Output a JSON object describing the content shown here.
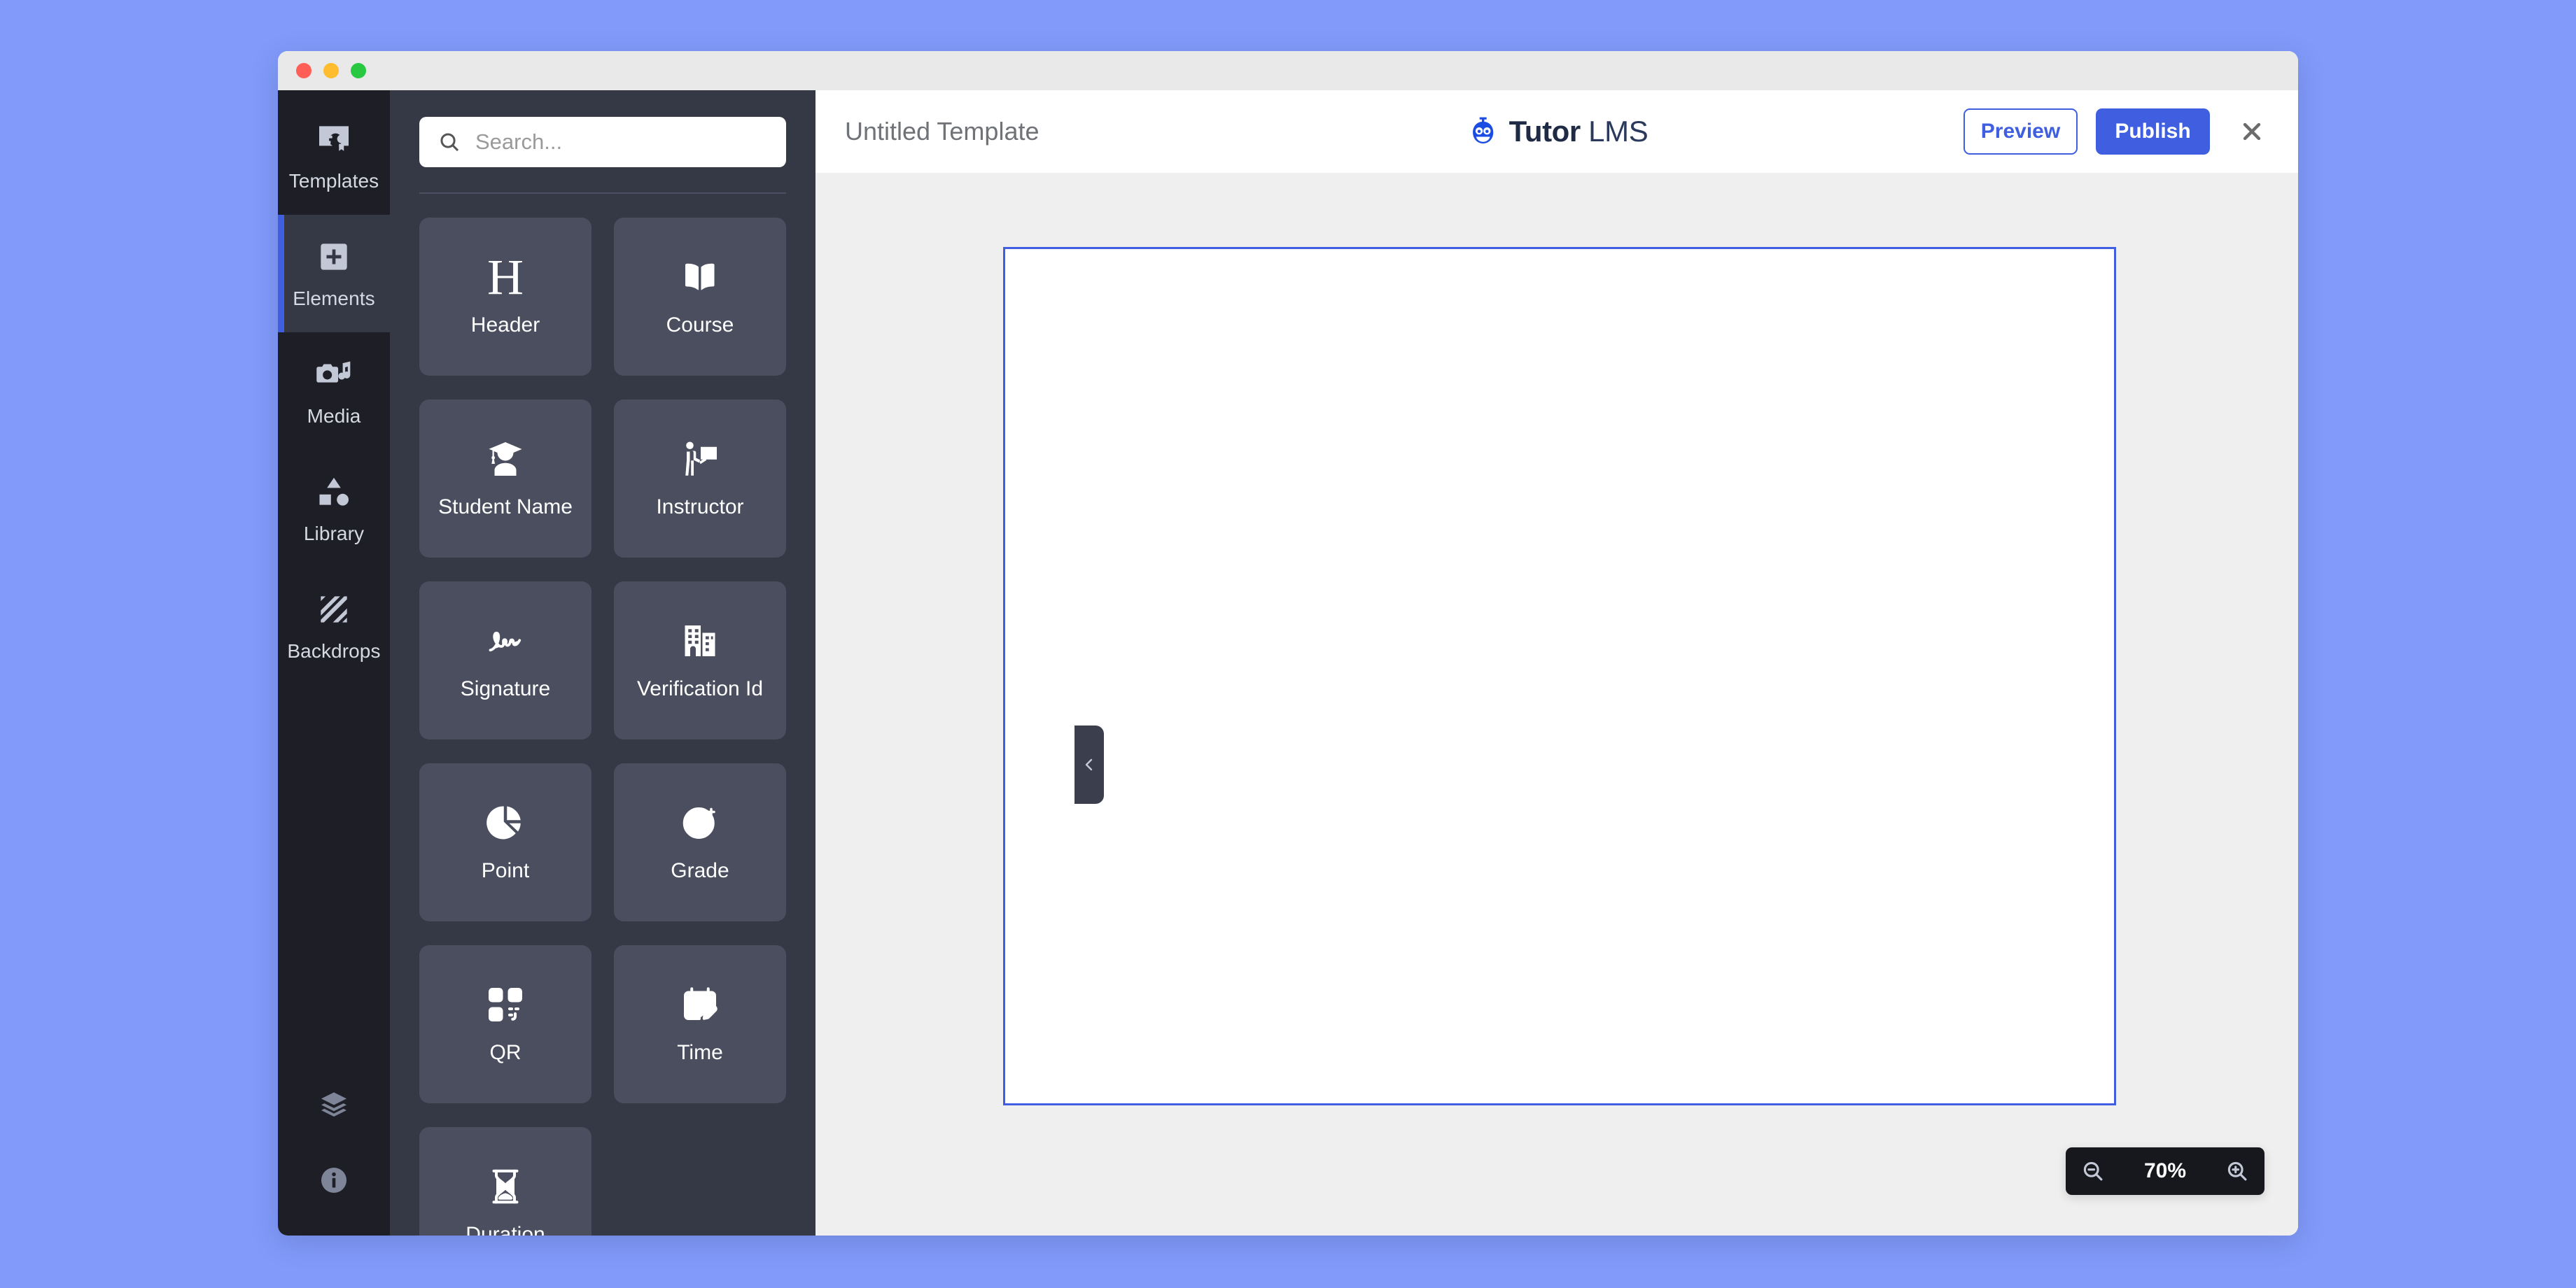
{
  "window": {
    "traffic_lights": [
      "close",
      "minimize",
      "maximize"
    ]
  },
  "rail": {
    "items": [
      {
        "label": "Templates",
        "icon": "certificate-icon",
        "active": false
      },
      {
        "label": "Elements",
        "icon": "plus-square-icon",
        "active": true
      },
      {
        "label": "Media",
        "icon": "media-icon",
        "active": false
      },
      {
        "label": "Library",
        "icon": "shapes-icon",
        "active": false
      },
      {
        "label": "Backdrops",
        "icon": "stripes-icon",
        "active": false
      }
    ],
    "bottom_items": [
      {
        "label": "Layers",
        "icon": "layers-icon"
      },
      {
        "label": "Info",
        "icon": "info-icon"
      }
    ]
  },
  "panel": {
    "search": {
      "placeholder": "Search...",
      "value": ""
    },
    "collapse_tooltip": "Collapse panel",
    "cards": [
      {
        "label": "Header",
        "icon": "heading-h-icon"
      },
      {
        "label": "Course",
        "icon": "open-book-icon"
      },
      {
        "label": "Student Name",
        "icon": "graduate-user-icon"
      },
      {
        "label": "Instructor",
        "icon": "instructor-board-icon"
      },
      {
        "label": "Signature",
        "icon": "signature-icon"
      },
      {
        "label": "Verification Id",
        "icon": "buildings-icon"
      },
      {
        "label": "Point",
        "icon": "pie-chart-icon"
      },
      {
        "label": "Grade",
        "icon": "a-plus-circle-icon"
      },
      {
        "label": "QR",
        "icon": "qr-code-icon"
      },
      {
        "label": "Time",
        "icon": "calendar-icon"
      },
      {
        "label": "Duration",
        "icon": "hourglass-icon"
      }
    ]
  },
  "topbar": {
    "document_title": "Untitled Template",
    "brand": {
      "name_bold": "Tutor",
      "name_light": "LMS",
      "logo": "tutor-lms-owl-icon"
    },
    "preview_label": "Preview",
    "publish_label": "Publish",
    "close_label": "Close"
  },
  "canvas": {
    "zoom_level": "70%",
    "zoom_out_icon": "magnifier-minus-icon",
    "zoom_in_icon": "magnifier-plus-icon"
  },
  "colors": {
    "page_background": "#829BFA",
    "accent_blue": "#3F5FE0",
    "rail_background": "#1E1F26",
    "panel_background": "#353845",
    "card_background": "#4A4E5E",
    "canvas_background": "#EFEFEF"
  }
}
